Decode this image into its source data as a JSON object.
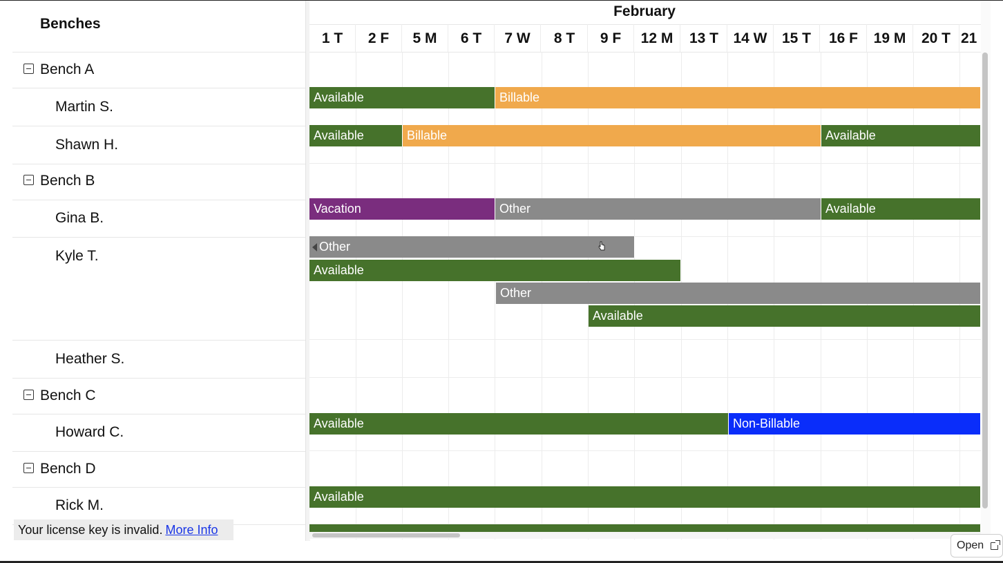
{
  "left_header": "Benches",
  "month": "February",
  "days": [
    "1 T",
    "2 F",
    "5 M",
    "6 T",
    "7 W",
    "8 T",
    "9 F",
    "12 M",
    "13 T",
    "14 W",
    "15 T",
    "16 F",
    "19 M",
    "20 T",
    "21"
  ],
  "rows": {
    "bench_a": "Bench A",
    "martin": "Martin S.",
    "shawn": "Shawn H.",
    "bench_b": "Bench B",
    "gina": "Gina B.",
    "kyle": "Kyle T.",
    "heather": "Heather S.",
    "bench_c": "Bench C",
    "howard": "Howard C.",
    "bench_d": "Bench D",
    "rick": "Rick M."
  },
  "events": {
    "martin_1": "Available",
    "martin_2": "Billable",
    "shawn_1": "Available",
    "shawn_2": "Billable",
    "shawn_3": "Available",
    "gina_1": "Vacation",
    "gina_2": "Other",
    "gina_3": "Available",
    "kyle_1": "Other",
    "kyle_2": "Available",
    "kyle_3": "Other",
    "kyle_4": "Available",
    "howard_1": "Available",
    "howard_2": "Non-Billable",
    "rick_1": "Available"
  },
  "license": {
    "text": "Your license key is invalid.",
    "link": "More Info"
  },
  "open_button": "Open",
  "colors": {
    "available": "#46722b",
    "billable": "#f0a94c",
    "vacation": "#7a2d7e",
    "other": "#8a8a8a",
    "non_billable": "#0a2dfa"
  }
}
